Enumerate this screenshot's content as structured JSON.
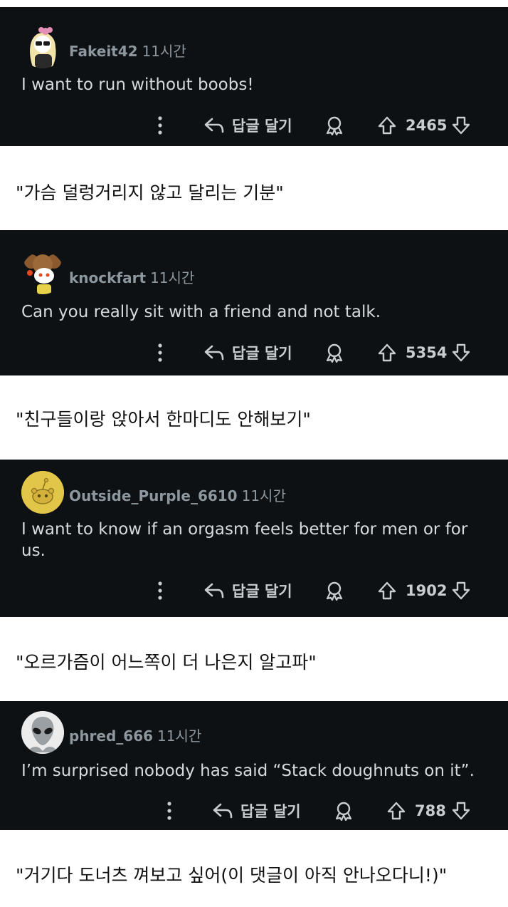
{
  "time_suffix": "11시간",
  "reply_label": "답글 달기",
  "comments": [
    {
      "user": "Fakeit42",
      "time": "11시간",
      "text": "I want to run without boobs!",
      "votes": "2465",
      "translation": "\"가슴 덜렁거리지 않고 달리는 기분\""
    },
    {
      "user": "knockfart",
      "time": "11시간",
      "text": "Can you really sit with a friend and not talk.",
      "votes": "5354",
      "translation": "\"친구들이랑 앉아서 한마디도 안해보기\""
    },
    {
      "user": "Outside_Purple_6610",
      "time": "11시간",
      "text": "I want to know if an orgasm feels better for men or for us.",
      "votes": "1902",
      "translation": "\"오르가즘이 어느쪽이 더 나은지 알고파\""
    },
    {
      "user": "phred_666",
      "time": "11시간",
      "text": "I’m surprised nobody has said “Stack doughnuts on it”.",
      "votes": "788",
      "translation": "\"거기다 도너츠 껴보고 싶어(이 댓글이 아직 안나오다니!)\""
    }
  ],
  "colors": {
    "panel_bg": "#0e1114",
    "meta_text": "#8d979e",
    "body_text": "#d7dadc"
  },
  "icons": [
    "more-dots-icon",
    "reply-arrow-icon",
    "award-icon",
    "upvote-icon",
    "downvote-icon"
  ]
}
